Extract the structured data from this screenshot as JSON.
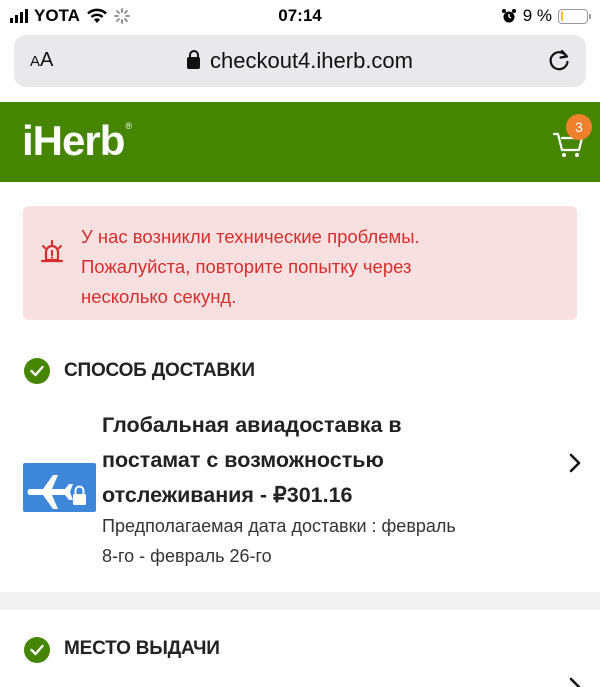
{
  "status_bar": {
    "carrier": "YOTA",
    "time": "07:14",
    "battery_percent": "9 %",
    "battery_level": 0.09,
    "battery_color": "#f2c21b"
  },
  "browser": {
    "text_size_label_small": "A",
    "text_size_label_large": "A",
    "url": "checkout4.iherb.com",
    "icons": [
      "lock-icon",
      "reload-icon"
    ]
  },
  "header": {
    "logo_text": "iHerb",
    "logo_mark": "®",
    "cart_count": "3",
    "brand_color": "#458500",
    "badge_color": "#f0812c"
  },
  "alert": {
    "lines": [
      "У нас возникли технические проблемы.",
      "Пожалуйста, повторите попытку через",
      "несколько секунд."
    ],
    "color": "#d62d2d",
    "background": "#f9e0e0",
    "icon": "alarm-bell-icon"
  },
  "shipping_section": {
    "title": "СПОСОБ ДОСТАВКИ",
    "method_lines": [
      "Глобальная авиадоставка в",
      "постамат с возможностью",
      "отслеживания - ₽301.16"
    ],
    "estimate_lines": [
      "Предполагаемая дата доставки : февраль",
      "8-го - февраль 26-го"
    ],
    "icon": "airplane-lock-icon",
    "icon_color": "#3e86d8"
  },
  "pickup_section": {
    "title": "МЕСТО ВЫДАЧИ"
  }
}
